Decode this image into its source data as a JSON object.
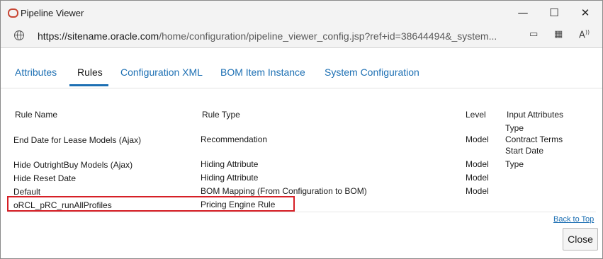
{
  "window": {
    "title": "Pipeline Viewer",
    "minimize_glyph": "—",
    "maximize_glyph": "☐",
    "close_glyph": "✕"
  },
  "address": {
    "host": "https://sitename.oracle.com",
    "path": "/home/configuration/pipeline_viewer_config.jsp?ref+id=38644494&_system...",
    "icons": [
      "open-in-app-icon",
      "extensions-icon",
      "read-aloud-icon"
    ]
  },
  "tabs": [
    {
      "label": "Attributes",
      "active": false
    },
    {
      "label": "Rules",
      "active": true
    },
    {
      "label": "Configuration XML",
      "active": false
    },
    {
      "label": "BOM Item Instance",
      "active": false
    },
    {
      "label": "System Configuration",
      "active": false
    }
  ],
  "table": {
    "headers": {
      "rule_name": "Rule Name",
      "rule_type": "Rule Type",
      "level": "Level",
      "input_attributes": "Input Attributes"
    },
    "rows": [
      {
        "name": "End Date for Lease Models (Ajax)",
        "type": "Recommendation",
        "level": "Model",
        "inputs": [
          "Type",
          "Contract Terms",
          "Start Date"
        ]
      },
      {
        "name": "Hide OutrightBuy Models (Ajax)",
        "type": "Hiding Attribute",
        "level": "Model",
        "inputs": [
          "Type"
        ]
      },
      {
        "name": "Hide Reset Date",
        "type": "Hiding Attribute",
        "level": "Model",
        "inputs": []
      },
      {
        "name": "Default",
        "type": "BOM Mapping (From Configuration to BOM)",
        "level": "Model",
        "inputs": []
      },
      {
        "name": "oRCL_pRC_runAllProfiles",
        "type": "Pricing Engine Rule",
        "level": "",
        "inputs": [],
        "highlighted": true
      }
    ]
  },
  "footer": {
    "back_to_top": "Back to Top",
    "close_label": "Close"
  },
  "colors": {
    "link": "#1c6fb3",
    "highlight_border": "#d61f26",
    "oracle_red": "#c74634"
  }
}
